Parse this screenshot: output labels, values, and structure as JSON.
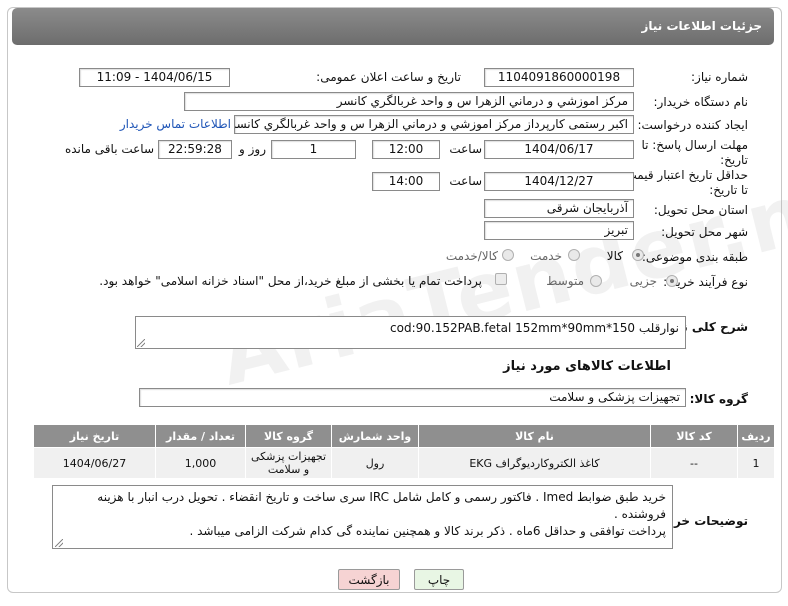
{
  "header": {
    "title": "جزئیات اطلاعات نیاز"
  },
  "fields": {
    "need_number_label": "شماره نیاز:",
    "need_number": "1104091860000198",
    "announce_label": "تاریخ و ساعت اعلان عمومی:",
    "announce_value": "1404/06/15 - 11:09",
    "buyer_org_label": "نام دستگاه خریدار:",
    "buyer_org": "مرکز اموزشي و درماني الزهرا س  و واحد غربالگري کانسر",
    "requester_label": "ایجاد کننده درخواست:",
    "requester": "اکبر رستمی کارپرداز مرکز اموزشي و درماني الزهرا س  و واحد غربالگري کانسر",
    "buyer_contact_link": "اطلاعات تماس خریدار",
    "deadline_label_1": "مهلت ارسال پاسخ: تا",
    "deadline_label_2": "تاریخ:",
    "deadline_date": "1404/06/17",
    "time_label": "ساعت",
    "deadline_time": "12:00",
    "days_value": "1",
    "days_label": "روز و",
    "remaining_time": "22:59:28",
    "remaining_label": "ساعت باقی مانده",
    "price_validity_label_1": "حداقل تاریخ اعتبار قیمت:",
    "price_validity_label_2": "تا تاریخ:",
    "price_validity_date": "1404/12/27",
    "price_validity_time": "14:00",
    "province_label": "استان محل تحویل:",
    "province": "آذربايجان شرقی",
    "city_label": "شهر محل تحویل:",
    "city": "تبریز",
    "category_label": "طبقه بندی موضوعی:",
    "category_options": [
      "کالا",
      "خدمت",
      "کالا/خدمت"
    ],
    "process_label": "نوع فرآیند خرید :",
    "process_options": [
      "جزیی",
      "متوسط"
    ],
    "payment_note": "پرداخت تمام یا بخشی از مبلغ خرید،از محل \"اسناد خزانه اسلامی\" خواهد بود."
  },
  "summary": {
    "label": "شرح کلی نیاز:",
    "text": "نوارقلب      cod:90.152PAB.fetal      152mm*90mm*150"
  },
  "goods_section": {
    "title": "اطلاعات کالاهای مورد نیاز",
    "group_label": "گروه کالا:",
    "group_value": "تجهیزات پزشکی و سلامت"
  },
  "table": {
    "headers": [
      "ردیف",
      "کد کالا",
      "نام کالا",
      "واحد شمارش",
      "گروه کالا",
      "تعداد / مقدار",
      "تاریخ نیاز"
    ],
    "rows": [
      [
        "1",
        "--",
        "كاغذ الكتروكارديوگراف EKG",
        "رول",
        "تجهیزات پزشکی و سلامت",
        "1,000",
        "1404/06/27"
      ]
    ]
  },
  "buyer_notes": {
    "label": "توضیحات خریدار:",
    "text": "خرید طبق ضوابط Imed . فاکتور رسمی و کامل شامل IRC سری ساخت و تاریخ انقضاء . تحویل درب انبار با هزینه فروشنده .\nپرداخت توافقی و حداقل 6ماه . ذکر برند کالا و همچنین نماینده گی کدام شرکت الزامی میباشد ."
  },
  "buttons": {
    "print": "چاپ",
    "back": "بازگشت"
  },
  "watermark": "AriaTender.neT",
  "colors": {
    "header_bg": "#7a7a7a",
    "link": "#1f55b7",
    "table_header": "#8f8f8f",
    "back_button": "#f6d3d3",
    "print_button": "#e8f6e4"
  }
}
